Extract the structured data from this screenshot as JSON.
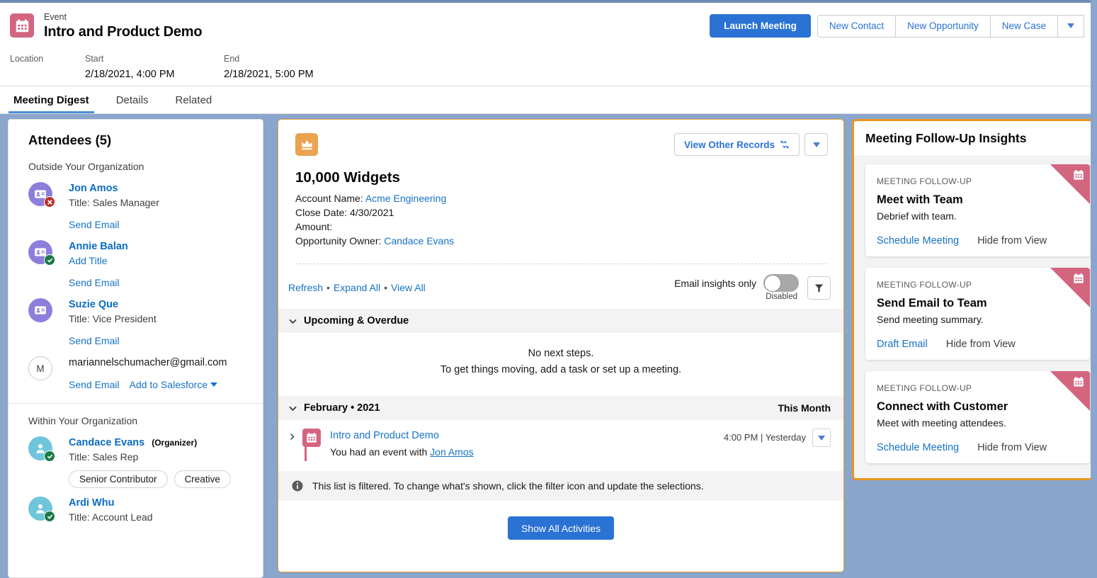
{
  "header": {
    "icon": "calendar-icon",
    "kicker": "Event",
    "title": "Intro and Product Demo",
    "primary_action": "Launch Meeting",
    "actions": [
      "New Contact",
      "New Opportunity",
      "New Case"
    ],
    "more_icon": "chevron-down-icon",
    "fields": [
      {
        "label": "Location",
        "value": ""
      },
      {
        "label": "Start",
        "value": "2/18/2021, 4:00 PM"
      },
      {
        "label": "End",
        "value": "2/18/2021, 5:00 PM"
      }
    ]
  },
  "tabs": [
    {
      "label": "Meeting Digest",
      "active": true
    },
    {
      "label": "Details",
      "active": false
    },
    {
      "label": "Related",
      "active": false
    }
  ],
  "attendees": {
    "title": "Attendees (5)",
    "groups": [
      {
        "label": "Outside Your Organization",
        "people": [
          {
            "name": "Jon Amos",
            "title": "Title: Sales Manager",
            "avatar": "contact-card-icon",
            "avatar_kind": "external",
            "status": "declined",
            "links": [
              "Send Email"
            ]
          },
          {
            "name": "Annie Balan",
            "title": "",
            "add_title": "Add Title",
            "avatar": "contact-card-icon",
            "avatar_kind": "external",
            "status": "accepted",
            "links": [
              "Send Email"
            ]
          },
          {
            "name": "Suzie Que",
            "title": "Title: Vice President",
            "avatar": "contact-card-icon",
            "avatar_kind": "external",
            "status": "none",
            "links": [
              "Send Email"
            ]
          },
          {
            "name": "",
            "email": "mariannelschumacher@gmail.com",
            "initial": "M",
            "avatar_kind": "initial",
            "status": "none",
            "links": [
              "Send Email",
              "Add to Salesforce"
            ]
          }
        ]
      },
      {
        "label": "Within Your Organization",
        "people": [
          {
            "name": "Candace Evans",
            "organizer_tag": "(Organizer)",
            "title": "Title: Sales Rep",
            "avatar": "person-icon",
            "avatar_kind": "internal",
            "status": "accepted",
            "pills": [
              "Senior Contributor",
              "Creative"
            ]
          },
          {
            "name": "Ardi Whu",
            "title": "Title: Account Lead",
            "avatar": "person-icon",
            "avatar_kind": "internal",
            "status": "accepted"
          }
        ]
      }
    ]
  },
  "opportunity": {
    "icon": "crown-icon",
    "view_other_records": "View Other Records",
    "view_other_records_icon": "record-swap-icon",
    "more_icon": "chevron-down-icon",
    "name": "10,000 Widgets",
    "fields": [
      {
        "label": "Account Name:",
        "value": "Acme Engineering",
        "is_link": true
      },
      {
        "label": "Close Date:",
        "value": "4/30/2021",
        "is_link": false
      },
      {
        "label": "Amount:",
        "value": "",
        "is_link": false
      },
      {
        "label": "Opportunity Owner:",
        "value": "Candace Evans",
        "is_link": true
      }
    ]
  },
  "activity": {
    "links": [
      "Refresh",
      "Expand All",
      "View All"
    ],
    "toggle_label": "Email insights only",
    "toggle_state": "Disabled",
    "filter_icon": "filter-icon",
    "sections": [
      {
        "label": "Upcoming & Overdue",
        "right": "",
        "empty_lines": [
          "No next steps.",
          "To get things moving, add a task or set up a meeting."
        ]
      },
      {
        "label": "February • 2021",
        "right": "This Month",
        "items": [
          {
            "icon": "calendar-icon",
            "title": "Intro and Product Demo",
            "description_prefix": "You had an event with ",
            "description_link": "Jon Amos",
            "time": "4:00 PM | Yesterday",
            "expand_icon": "chevron-right-icon",
            "row_menu_icon": "chevron-down-icon"
          }
        ]
      }
    ],
    "note_icon": "info-icon",
    "note": "This list is filtered. To change what's shown, click the filter icon and update the selections.",
    "show_all": "Show All Activities"
  },
  "insights": {
    "title": "Meeting Follow-Up Insights",
    "cards": [
      {
        "kicker": "MEETING FOLLOW-UP",
        "title": "Meet with Team",
        "description": "Debrief with team.",
        "primary_action": "Schedule Meeting",
        "secondary_action": "Hide from View",
        "corner_icon": "calendar-icon"
      },
      {
        "kicker": "MEETING FOLLOW-UP",
        "title": "Send Email to Team",
        "description": "Send meeting summary.",
        "primary_action": "Draft Email",
        "secondary_action": "Hide from View",
        "corner_icon": "calendar-icon"
      },
      {
        "kicker": "MEETING FOLLOW-UP",
        "title": "Connect with Customer",
        "description": "Meet with meeting attendees.",
        "primary_action": "Schedule Meeting",
        "secondary_action": "Hide from View",
        "corner_icon": "calendar-icon"
      }
    ]
  },
  "colors": {
    "brand_blue": "#2a72d4",
    "link_blue": "#1573c6",
    "event_pink": "#d4657f",
    "opportunity_orange": "#eba34f",
    "insight_border": "#e8971f",
    "avatar_purple": "#8c7fdb",
    "avatar_teal": "#6fc5da",
    "status_green": "#1a7a45",
    "status_red": "#b7342a"
  }
}
